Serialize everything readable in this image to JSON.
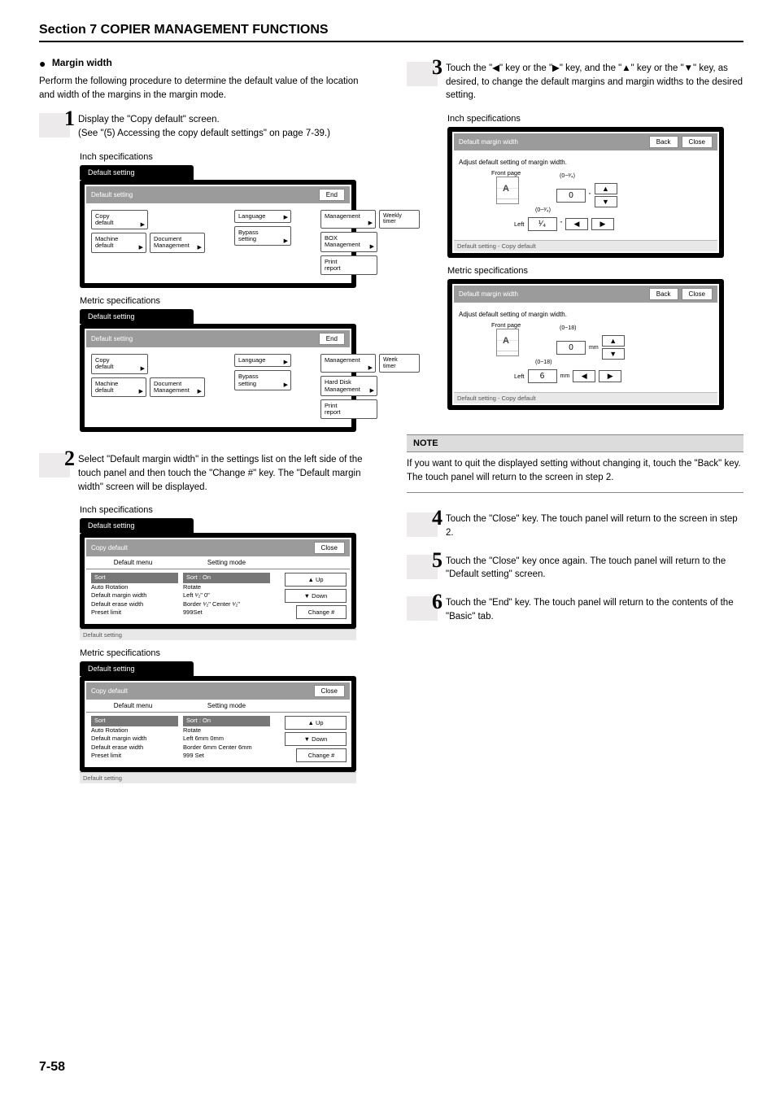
{
  "section_title": "Section 7  COPIER MANAGEMENT FUNCTIONS",
  "page_number": "7-58",
  "heading": {
    "bullet": "●",
    "text": "Margin width"
  },
  "intro": "Perform the following procedure to determine the default value of the location and width of the margins in the margin mode.",
  "step1": {
    "num": "1",
    "line1": "Display the \"Copy default\" screen.",
    "line2": "(See \"(5) Accessing the copy default settings\" on page 7-39.)",
    "spec_inch": "Inch specifications",
    "spec_metric": "Metric specifications"
  },
  "panel1": {
    "tab": "Default setting",
    "hdr_title": "Default setting",
    "end": "End",
    "buttons_inch": {
      "copy_default": "Copy\ndefault",
      "machine_default": "Machine\ndefault",
      "document_mgmt": "Document\nManagement",
      "language": "Language",
      "bypass_setting": "Bypass\nsetting",
      "management": "Management",
      "box_mgmt": "BOX\nManagement",
      "print_report": "Print\nreport",
      "weekly_timer": "Weekly\ntimer"
    },
    "buttons_metric": {
      "copy_default": "Copy\ndefault",
      "machine_default": "Machine\ndefault",
      "document_mgmt": "Document\nManagement",
      "language": "Language",
      "bypass_setting": "Bypass\nsetting",
      "management": "Management",
      "hard_disk": "Hard Disk\nManagement",
      "print_report": "Print\nreport",
      "week_timer": "Week\ntimer"
    }
  },
  "step2": {
    "num": "2",
    "text": "Select \"Default margin width\" in the settings list on the left side of the touch panel and then touch the \"Change #\" key. The \"Default margin width\" screen will be displayed.",
    "spec_inch": "Inch specifications",
    "spec_metric": "Metric specifications"
  },
  "panel2": {
    "tab": "Default setting",
    "hdr_title": "Copy default",
    "close": "Close",
    "col1": "Default menu",
    "col2": "Setting mode",
    "up": "Up",
    "down": "Down",
    "change": "Change #",
    "footer": "Default setting",
    "rows_inch": {
      "sort": "Sort",
      "auto_rotation": "Auto Rotation",
      "def_margin": "Default margin width",
      "def_erase": "Default erase width",
      "preset": "Preset limit",
      "sort_on": "Sort : On",
      "rotate": "Rotate",
      "left_val": "Left ¹⁄₂\"    0\"",
      "border_val": "Border ¹⁄₂\"    Center ¹⁄₂\"",
      "limit": "999Set"
    },
    "rows_metric": {
      "sort": "Sort",
      "auto_rotation": "Auto Rotation",
      "def_margin": "Default margin width",
      "def_erase": "Default erase width",
      "preset": "Preset limit",
      "sort_on": "Sort : On",
      "rotate": "Rotate",
      "left_val": "Left 6mm    0mm",
      "border_val": "Border 6mm  Center 6mm",
      "limit": "999 Set"
    }
  },
  "step3": {
    "num": "3",
    "text": "Touch the \"◀\" key or the \"▶\" key, and the \"▲\" key or the \"▼\" key, as desired, to change the default margins and margin widths to the desired setting.",
    "spec_inch": "Inch specifications",
    "spec_metric": "Metric specifications"
  },
  "panel3": {
    "hdr_title": "Default margin width",
    "back": "Back",
    "close": "Close",
    "adj_title": "Adjust default setting of margin width.",
    "front_page": "Front page",
    "footer": "Default setting - Copy default",
    "inch": {
      "range": "(0~³⁄₄)",
      "value_top": "0",
      "left": "Left",
      "value_left": "¹⁄₄",
      "unit": "\""
    },
    "metric": {
      "range": "(0~18)",
      "value_top": "0",
      "mm_top": "mm",
      "left": "Left",
      "value_left": "6",
      "mm_left": "mm"
    }
  },
  "note": {
    "label": "NOTE",
    "text": "If you want to quit the displayed setting without changing it, touch the \"Back\" key. The touch panel will return to the screen in step 2."
  },
  "step4": {
    "num": "4",
    "text": "Touch the \"Close\" key. The touch panel will return to the screen in step 2."
  },
  "step5": {
    "num": "5",
    "text": "Touch the \"Close\" key once again. The touch panel will return to the \"Default setting\" screen."
  },
  "step6": {
    "num": "6",
    "text": "Touch the \"End\" key. The touch panel will return to the contents of the \"Basic\" tab."
  }
}
